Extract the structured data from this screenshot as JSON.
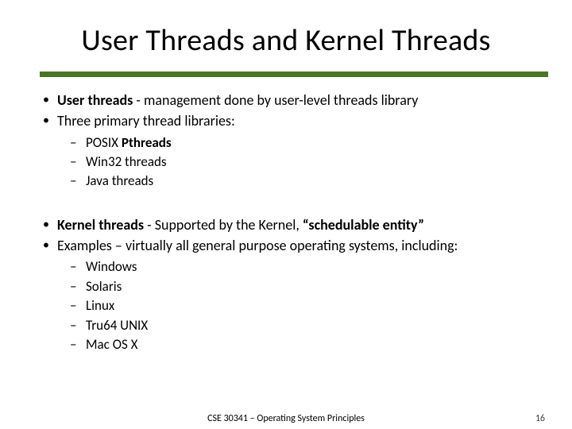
{
  "title": "User Threads and Kernel Threads",
  "bullets": {
    "b1": {
      "strong": "User threads",
      "rest": " - management done by user-level threads library"
    },
    "b2": "Three primary thread libraries:",
    "lib": {
      "l1_pre": "POSIX ",
      "l1_strong": "Pthreads",
      "l2": "Win32 threads",
      "l3": "Java threads"
    },
    "b3": {
      "strong1": "Kernel threads",
      "mid": " - Supported by the Kernel, ",
      "strong2": "“schedulable entity”"
    },
    "b4": "Examples – virtually all general purpose operating systems, including:",
    "os": {
      "o1": "Windows",
      "o2": "Solaris",
      "o3": "Linux",
      "o4": "Tru64 UNIX",
      "o5": "Mac OS X"
    }
  },
  "footer": {
    "course": "CSE 30341 – Operating System Principles",
    "page": "16"
  }
}
